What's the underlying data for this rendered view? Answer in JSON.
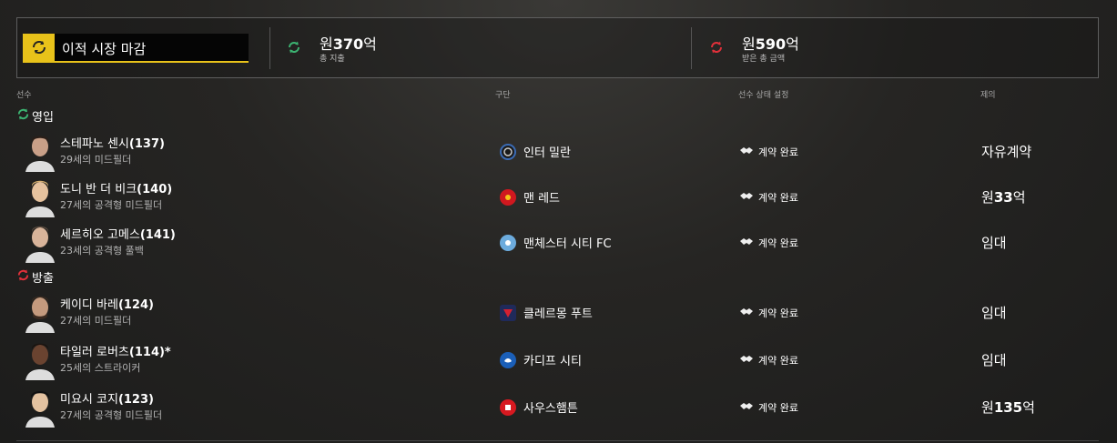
{
  "summary": {
    "deadline_label": "이적 시장 마감",
    "spent": {
      "currency": "원",
      "amount": "370",
      "unit": "억",
      "label": "총 지출"
    },
    "received": {
      "currency": "원",
      "amount": "590",
      "unit": "억",
      "label": "받은 총 금액"
    }
  },
  "columns": {
    "player": "선수",
    "club": "구단",
    "status": "선수 상태 설정",
    "offer": "제의"
  },
  "sections": {
    "incoming": "영입",
    "outgoing": "방출"
  },
  "incoming": [
    {
      "name": "스테파노 센시",
      "rating": "(137)",
      "desc": "29세의 미드필더",
      "club": "인터 밀란",
      "status": "계약 완료",
      "offer": "자유계약"
    },
    {
      "name": "도니 반 더 비크",
      "rating": "(140)",
      "desc": "27세의 공격형 미드필더",
      "club": "맨 레드",
      "status": "계약 완료",
      "offer_currency": "원",
      "offer_amount": "33",
      "offer_unit": "억"
    },
    {
      "name": "세르히오 고메스",
      "rating": "(141)",
      "desc": "23세의 공격형 풀백",
      "club": "맨체스터 시티 FC",
      "status": "계약 완료",
      "offer": "임대"
    }
  ],
  "outgoing": [
    {
      "name": "케이디 바레",
      "rating": "(124)",
      "desc": "27세의 미드필더",
      "club": "클레르몽 푸트",
      "status": "계약 완료",
      "offer": "임대"
    },
    {
      "name": "타일러 로버츠",
      "rating": "(114)*",
      "desc": "25세의 스트라이커",
      "club": "카디프 시티",
      "status": "계약 완료",
      "offer": "임대"
    },
    {
      "name": "미요시 코지",
      "rating": "(123)",
      "desc": "27세의 공격형 미드필더",
      "club": "사우스햄튼",
      "status": "계약 완료",
      "offer_currency": "원",
      "offer_amount": "135",
      "offer_unit": "억"
    }
  ],
  "colors": {
    "accent": "#e8c21a",
    "incoming": "#3cb371",
    "outgoing": "#e0303a"
  }
}
